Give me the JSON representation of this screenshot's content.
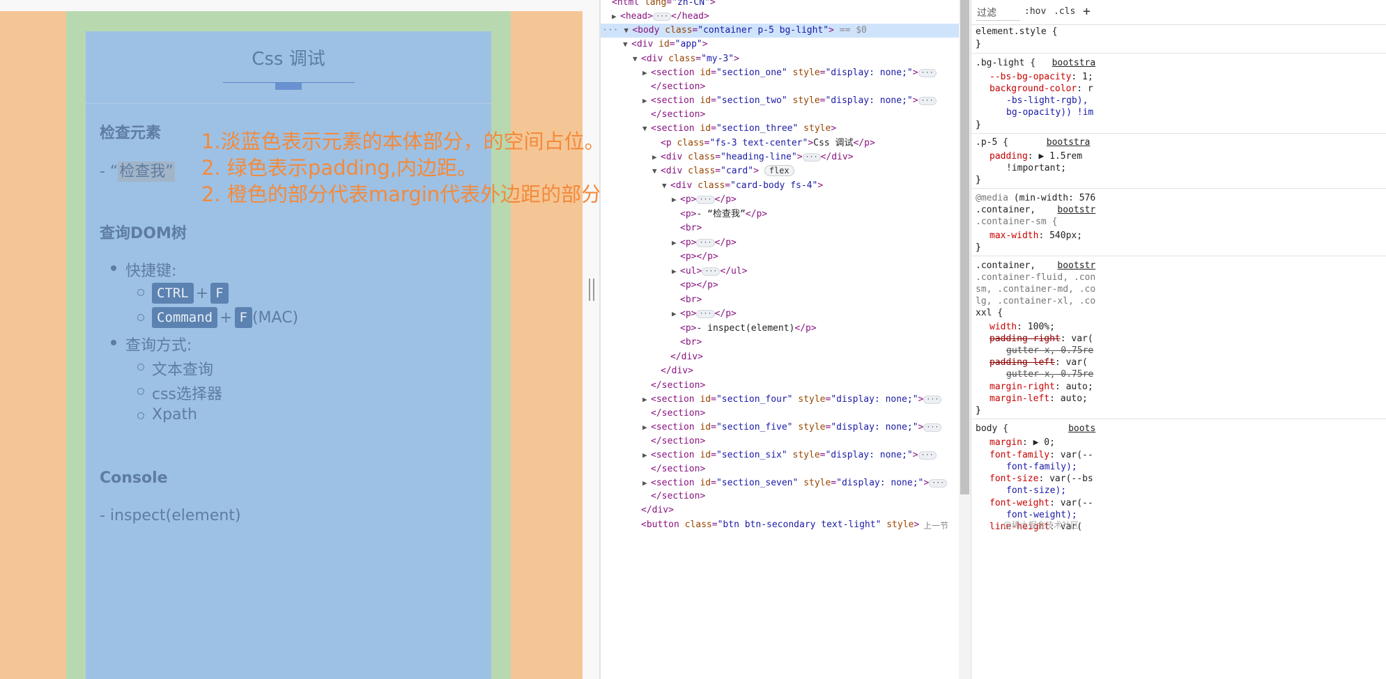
{
  "page": {
    "card_title": "Css 调试",
    "sections": {
      "inspect_title": "检查元素",
      "inspect_text_prefix": "- “",
      "inspect_text_main": "检查我",
      "inspect_text_suffix": "”",
      "dom_title": "查询DOM树",
      "shortcut_label": "快捷键:",
      "kbd_ctrl": "CTRL",
      "kbd_f": "F",
      "kbd_command": "Command",
      "plus": "+",
      "mac": "(MAC)",
      "query_label": "查询方式:",
      "query_items": [
        "文本查询",
        "css选择器",
        "Xpath"
      ],
      "console_title": "Console",
      "console_text": "- inspect(element)"
    },
    "annotations": [
      "1.淡蓝色表示元素的本体部分，的空间占位。",
      "2. 绿色表示padding,内边距。",
      "2. 橙色的部分代表margin代表外边距的部分"
    ]
  },
  "devtools": {
    "elements": [
      {
        "text_tag_open": "<html ",
        "attr": "lang",
        "val": "\"zh-CN\"",
        "close": ">"
      },
      {
        "tag": "head"
      },
      {
        "body_class": "\"container p-5 bg-light\"",
        "suffix": " == $0"
      },
      {
        "div_id": "\"app\""
      },
      {
        "div_class": "\"my-3\""
      },
      {
        "section_one": "\"section_one\"",
        "style": "\"display: none;\""
      },
      {
        "section_two": "\"section_two\""
      },
      {
        "section_three": "\"section_three\""
      },
      {
        "p_class": "\"fs-3 text-center\"",
        "p_text": "Css 调试"
      },
      {
        "heading_line": "\"heading-line\""
      },
      {
        "card": "\"card\"",
        "badge": "flex"
      },
      {
        "card_body": "\"card-body fs-4\""
      },
      {
        "p_inspect": "- “检查我”"
      },
      {
        "p_inspect2": "- inspect(element)"
      },
      {
        "section_four": "\"section_four\""
      },
      {
        "section_five": "\"section_five\""
      },
      {
        "section_six": "\"section_six\""
      },
      {
        "section_seven": "\"section_seven\""
      },
      {
        "button_class": "\"btn btn-secondary text-light\""
      }
    ],
    "button_prev": "上一节",
    "watermark": "@稀土掘金技术社区"
  },
  "styles": {
    "filter_placeholder": "过滤",
    "hov": ":hov",
    "cls": ".cls",
    "plus": "+",
    "rules": {
      "element_style": "element.style {",
      "close": "}",
      "bg_light": ".bg-light {",
      "bootstrap": "bootstra",
      "bs_bg_opacity": "--bs-bg-opacity",
      "bs_bg_opacity_val": ": 1;",
      "bg_color": "background-color",
      "bg_color_val": ": r",
      "bg_color_l2": "-bs-light-rgb),",
      "bg_color_l3": "bg-opacity)) !im",
      "p5": ".p-5 {",
      "padding": "padding",
      "padding_val": "1.5rem",
      "important": "!important;",
      "media": "@media",
      "media_val": " (min-width: 576",
      "container": ".container,",
      "bootstr": "bootstr",
      "container_sm": ".container-sm {",
      "max_width": "max-width",
      "max_width_val": ": 540px;",
      "container2": ".container,",
      "container_fluid": ".container-fluid, .con",
      "sm_md": "sm, .container-md, .co",
      "lg_xl": "lg, .container-xl, .co",
      "xxl": "xxl {",
      "width": "width",
      "width_val": ": 100%;",
      "padding_right": "padding-right",
      "padding_right_val": ": var(",
      "gutter_x": "gutter-x, 0.75re",
      "padding_left": "padding-left",
      "padding_left_val": ": var(",
      "margin_right": "margin-right",
      "margin_right_val": ": auto;",
      "margin_left": "margin-left",
      "margin_left_val": ": auto;",
      "body": "body {",
      "boots": "boots",
      "margin": "margin",
      "margin_val": "0;",
      "font_family": "font-family",
      "font_family_val": ": var(--",
      "font_family_l2": "font-family);",
      "font_size": "font-size",
      "font_size_val": ": var(--bs",
      "font_size_l2": "font-size);",
      "font_weight": "font-weight",
      "font_weight_val": ": var(--",
      "font_weight_l2": "font-weight);",
      "line_height": "line-height",
      "line_height_val": ": var("
    }
  }
}
